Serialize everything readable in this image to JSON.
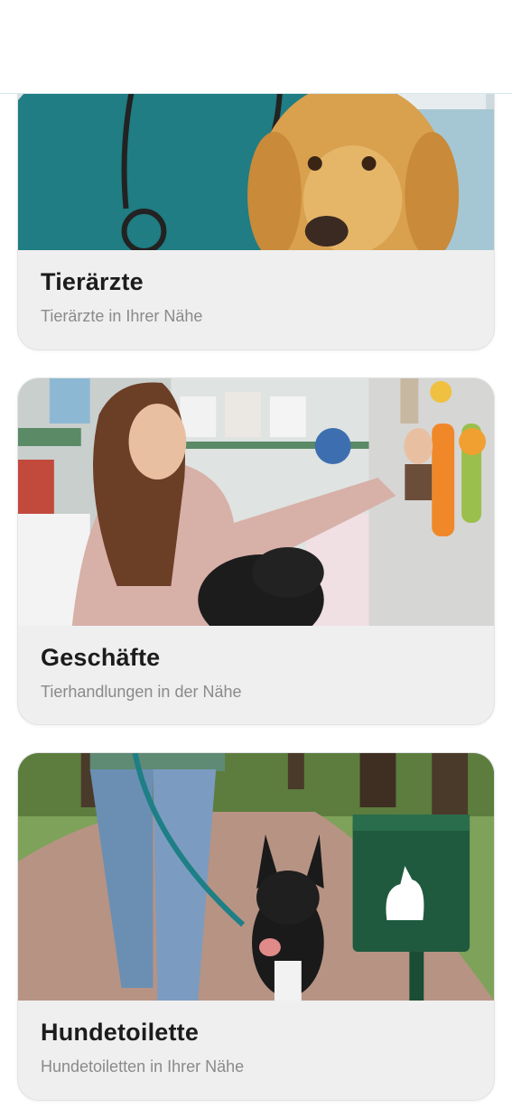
{
  "cards": [
    {
      "title": "Tierärzte",
      "subtitle": "Tierärzte in Ihrer Nähe",
      "image": "veterinarian-with-golden-retriever"
    },
    {
      "title": "Geschäfte",
      "subtitle": "Tierhandlungen in der Nähe",
      "image": "woman-with-dog-in-pet-shop"
    },
    {
      "title": "Hundetoilette",
      "subtitle": "Hundetoiletten in Ihrer Nähe",
      "image": "dog-walk-with-waste-bag-dispenser"
    }
  ],
  "colors": {
    "card_background": "#efefef",
    "title_text": "#1c1c1c",
    "subtitle_text": "#8a8a8a",
    "header_divider": "#d6e8ec"
  }
}
